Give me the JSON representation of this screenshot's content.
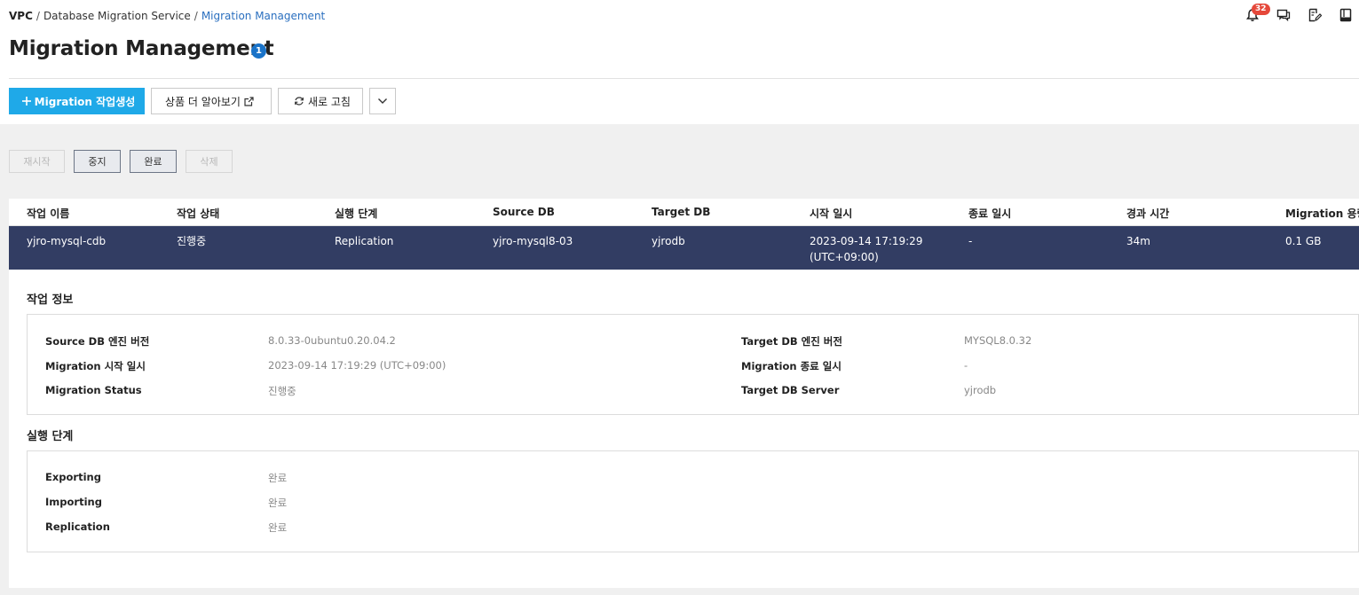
{
  "breadcrumb": {
    "root": "VPC",
    "sep": "/",
    "service": "Database Migration Service",
    "current": "Migration Management"
  },
  "header": {
    "title": "Migration Management",
    "info_badge": "1",
    "notification_count": "32"
  },
  "toolbar": {
    "create_label": "Migration 작업생성",
    "learn_more_label": "상품 더 알아보기",
    "refresh_label": "새로 고침"
  },
  "actions": {
    "restart": "재시작",
    "stop": "중지",
    "complete": "완료",
    "delete": "삭제"
  },
  "table": {
    "columns": [
      "작업 이름",
      "작업 상태",
      "실행 단계",
      "Source DB",
      "Target DB",
      "시작 일시",
      "종료 일시",
      "경과 시간",
      "Migration 용량"
    ],
    "rows": [
      {
        "name": "yjro-mysql-cdb",
        "status": "진행중",
        "stage": "Replication",
        "source_db": "yjro-mysql8-03",
        "target_db": "yjrodb",
        "start_date": "2023-09-14 17:19:29",
        "start_tz": "(UTC+09:00)",
        "end_date": "-",
        "elapsed": "34m",
        "size": "0.1 GB"
      }
    ]
  },
  "job_info": {
    "title": "작업 정보",
    "items": [
      {
        "label": "Source DB 엔진 버전",
        "value": "8.0.33-0ubuntu0.20.04.2"
      },
      {
        "label": "Migration 시작 일시",
        "value": "2023-09-14 17:19:29 (UTC+09:00)"
      },
      {
        "label": "Migration Status",
        "value": "진행중"
      },
      {
        "label": "Target DB 엔진 버전",
        "value": "MYSQL8.0.32"
      },
      {
        "label": "Migration 종료 일시",
        "value": "-"
      },
      {
        "label": "Target DB Server",
        "value": "yjrodb"
      }
    ]
  },
  "stages": {
    "title": "실행 단계",
    "items": [
      {
        "label": "Exporting",
        "value": "완료"
      },
      {
        "label": "Importing",
        "value": "완료"
      },
      {
        "label": "Replication",
        "value": "완료"
      }
    ]
  },
  "colors": {
    "primary": "#1fa9e8",
    "selected_row": "#323d63",
    "link": "#2a6fbf",
    "badge": "#e5483a",
    "info": "#1a73c8"
  }
}
